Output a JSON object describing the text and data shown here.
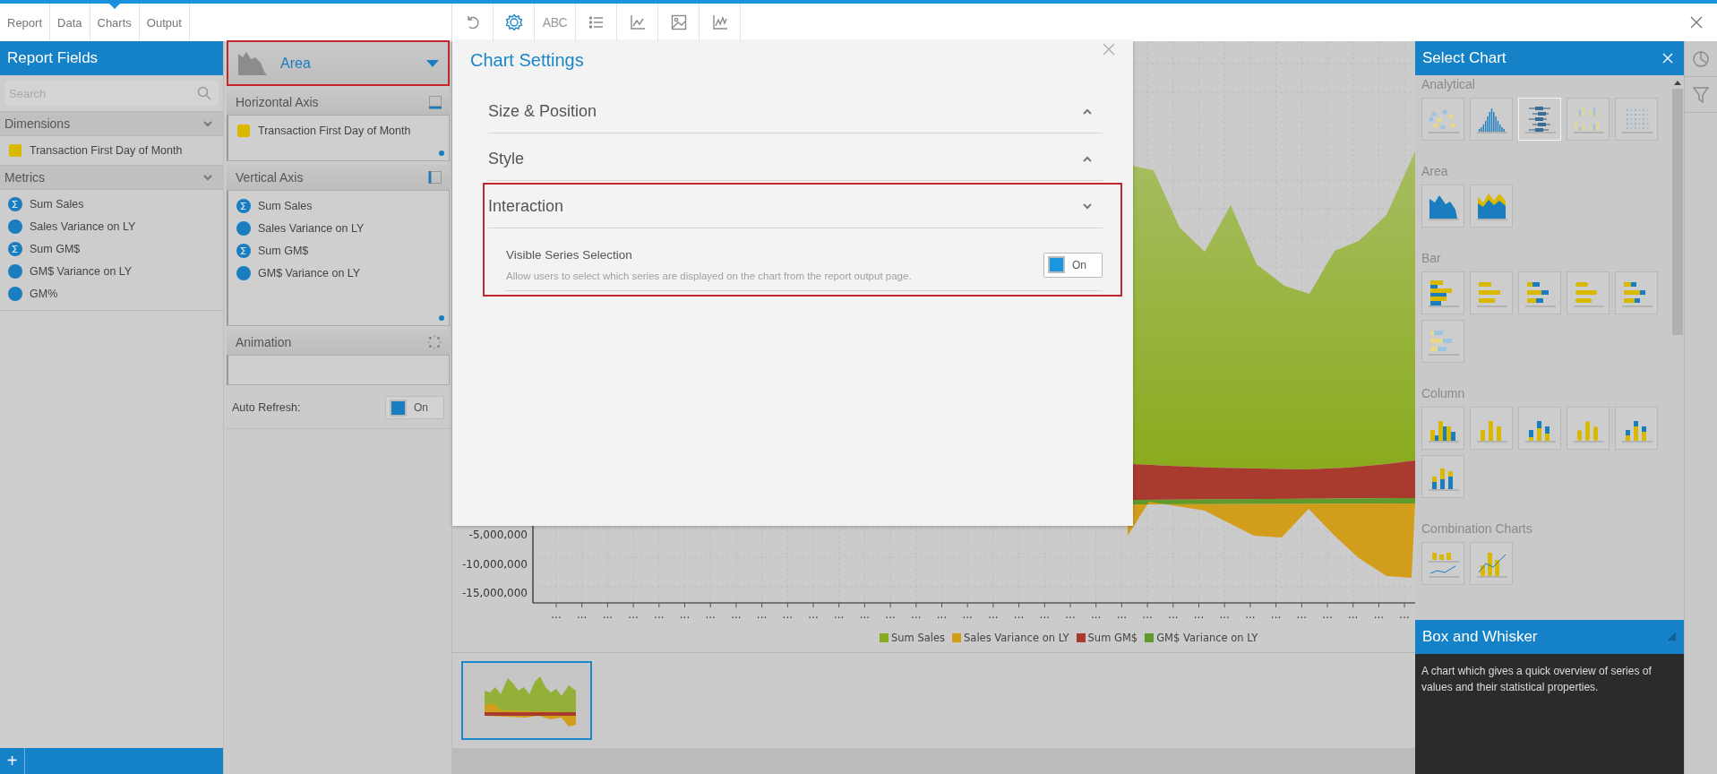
{
  "top_tabs": [
    {
      "label": "Report",
      "selected": false
    },
    {
      "label": "Data",
      "selected": false
    },
    {
      "label": "Charts",
      "selected": true
    },
    {
      "label": "Output",
      "selected": false
    }
  ],
  "toolbar": [
    {
      "kind": "undo",
      "selected": false
    },
    {
      "kind": "settings",
      "selected": true
    },
    {
      "kind": "text",
      "label": "ABC",
      "selected": false
    },
    {
      "kind": "list",
      "selected": false
    },
    {
      "kind": "axes",
      "selected": false
    },
    {
      "kind": "image",
      "selected": false
    },
    {
      "kind": "line",
      "selected": false
    }
  ],
  "report_fields": {
    "title": "Report Fields",
    "search": {
      "placeholder": "Search"
    },
    "add_button": "+",
    "groups": [
      {
        "title": "Dimensions",
        "expanded": true,
        "items": [
          {
            "label": "Transaction First Day of Month",
            "kind": "dimension"
          }
        ]
      },
      {
        "title": "Metrics",
        "expanded": true,
        "items": [
          {
            "label": "Sum Sales",
            "kind": "sum"
          },
          {
            "label": "Sales Variance on LY",
            "kind": "metric"
          },
          {
            "label": "Sum GM$",
            "kind": "sum"
          },
          {
            "label": "GM$ Variance on LY",
            "kind": "metric"
          },
          {
            "label": "GM%",
            "kind": "metric"
          }
        ]
      }
    ]
  },
  "chart_type": {
    "label": "Area",
    "highlighted": true
  },
  "horizontal_axis": {
    "title": "Horizontal Axis",
    "fields": [
      {
        "label": "Transaction First Day of Month",
        "kind": "dimension"
      }
    ]
  },
  "vertical_axis": {
    "title": "Vertical Axis",
    "fields": [
      {
        "label": "Sum Sales",
        "kind": "sum"
      },
      {
        "label": "Sales Variance on LY",
        "kind": "metric"
      },
      {
        "label": "Sum GM$",
        "kind": "sum"
      },
      {
        "label": "GM$ Variance on LY",
        "kind": "metric"
      }
    ]
  },
  "animation": {
    "title": "Animation"
  },
  "auto_refresh": {
    "label": "Auto Refresh:",
    "toggle": {
      "label": "On",
      "on": true
    }
  },
  "chart_settings": {
    "title": "Chart Settings",
    "sections": [
      {
        "title": "Size & Position",
        "expanded": false,
        "highlighted": false
      },
      {
        "title": "Style",
        "expanded": false,
        "highlighted": false
      },
      {
        "title": "Interaction",
        "expanded": true,
        "highlighted": true,
        "options": [
          {
            "label": "Visible Series Selection",
            "description": "Allow users to select which series are displayed on the chart from the report output page.",
            "toggle": {
              "label": "On",
              "on": true
            }
          }
        ]
      }
    ]
  },
  "chart": {
    "y_tick_labels": [
      "-5,000,000",
      "-10,000,000",
      "-15,000,000"
    ],
    "x_tick_labels": [
      "...",
      "...",
      "...",
      "...",
      "...",
      "...",
      "...",
      "...",
      "...",
      "...",
      "...",
      "...",
      "...",
      "...",
      "...",
      "...",
      "...",
      "...",
      "...",
      "...",
      "...",
      "...",
      "...",
      "...",
      "...",
      "...",
      "...",
      "...",
      "...",
      "...",
      "...",
      "...",
      "...",
      "..."
    ],
    "legend": [
      {
        "label": "Sum Sales",
        "color": "#8aab1e"
      },
      {
        "label": "Sales Variance on LY",
        "color": "#d39d1c"
      },
      {
        "label": "Sum GM$",
        "color": "#a83a2e"
      },
      {
        "label": "GM$ Variance on LY",
        "color": "#5f9a2a"
      }
    ]
  },
  "thumbnails": [
    {
      "selected": true
    }
  ],
  "select_chart": {
    "title": "Select Chart",
    "categories": [
      {
        "title": "Analytical",
        "charts": [
          {
            "kind": "scatter",
            "selected": false
          },
          {
            "kind": "histogram",
            "selected": false
          },
          {
            "kind": "box",
            "selected": true
          },
          {
            "kind": "multi-column",
            "selected": false
          },
          {
            "kind": "dot-grid",
            "selected": false
          }
        ]
      },
      {
        "title": "Area",
        "charts": [
          {
            "kind": "area",
            "selected": false
          },
          {
            "kind": "stacked-area",
            "selected": false
          }
        ]
      },
      {
        "title": "Bar",
        "charts": [
          {
            "kind": "bar-grouped",
            "selected": false
          },
          {
            "kind": "bar",
            "selected": false
          },
          {
            "kind": "bar-stacked",
            "selected": false
          },
          {
            "kind": "bar-cylinder",
            "selected": false
          },
          {
            "kind": "bar-3d",
            "selected": false
          },
          {
            "kind": "bar-pale",
            "selected": false
          }
        ]
      },
      {
        "title": "Column",
        "charts": [
          {
            "kind": "column-grouped",
            "selected": false
          },
          {
            "kind": "column",
            "selected": false
          },
          {
            "kind": "column-stacked",
            "selected": false
          },
          {
            "kind": "column-cylinder",
            "selected": false
          },
          {
            "kind": "column-3d",
            "selected": false
          },
          {
            "kind": "column-stacked-tall",
            "selected": false
          }
        ]
      },
      {
        "title": "Combination Charts",
        "charts": [
          {
            "kind": "combo-split",
            "selected": false
          },
          {
            "kind": "combo-overlay",
            "selected": false
          }
        ]
      }
    ]
  },
  "description": {
    "title": "Box and Whisker",
    "text": "A chart which gives a quick overview of series of values and their statistical properties."
  }
}
